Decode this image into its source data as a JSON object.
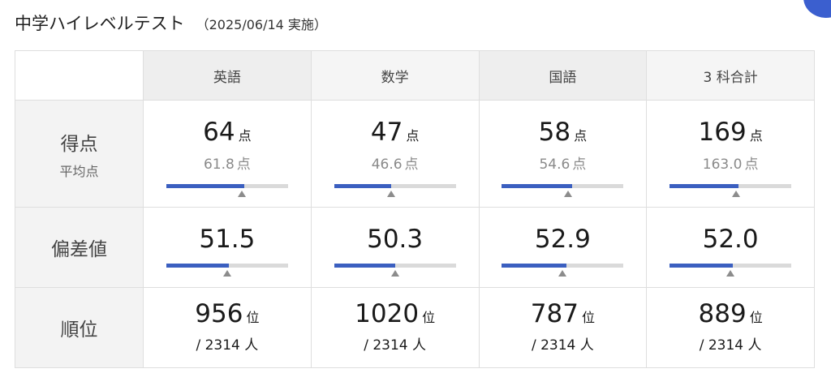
{
  "page": {
    "title": "中学ハイレベルテスト",
    "date": "（2025/06/14 実施）"
  },
  "header": {
    "subjects": [
      "英語",
      "数学",
      "国語",
      "3 科合計"
    ]
  },
  "rows": {
    "score": {
      "label": "得点",
      "sublabel": "平均点",
      "unit": "点",
      "cells": [
        {
          "value": "64",
          "average": "61.8",
          "fill": 0.64,
          "avg_fill": 0.618
        },
        {
          "value": "47",
          "average": "46.6",
          "fill": 0.47,
          "avg_fill": 0.466
        },
        {
          "value": "58",
          "average": "54.6",
          "fill": 0.58,
          "avg_fill": 0.546
        },
        {
          "value": "169",
          "average": "163.0",
          "fill": 0.563,
          "avg_fill": 0.543
        }
      ]
    },
    "deviation": {
      "label": "偏差値",
      "cells": [
        {
          "value": "51.5",
          "fill": 0.515,
          "avg_fill": 0.5
        },
        {
          "value": "50.3",
          "fill": 0.503,
          "avg_fill": 0.5
        },
        {
          "value": "52.9",
          "fill": 0.529,
          "avg_fill": 0.5
        },
        {
          "value": "52.0",
          "fill": 0.52,
          "avg_fill": 0.5
        }
      ]
    },
    "rank": {
      "label": "順位",
      "unit": "位",
      "total_prefix": "/ ",
      "total_unit": "人",
      "cells": [
        {
          "value": "956",
          "total": "2314"
        },
        {
          "value": "1020",
          "total": "2314"
        },
        {
          "value": "787",
          "total": "2314"
        },
        {
          "value": "889",
          "total": "2314"
        }
      ]
    }
  },
  "colors": {
    "bar_fill": "#3b5fc0",
    "bar_track": "#dadada",
    "marker": "#8c8c8c",
    "accent": "#3b5fcf"
  }
}
